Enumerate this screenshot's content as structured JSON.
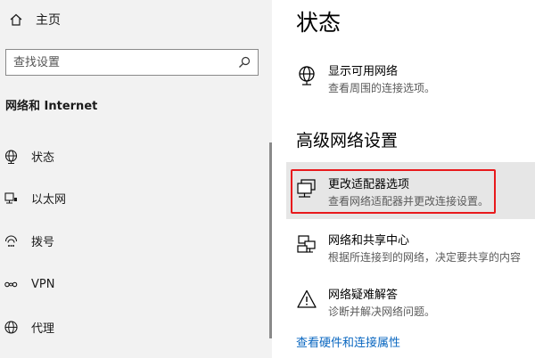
{
  "sidebar": {
    "home_label": "主页",
    "search": {
      "placeholder": "查找设置"
    },
    "section_label": "网络和 Internet",
    "items": [
      {
        "label": "状态",
        "icon": "globe-icon"
      },
      {
        "label": "以太网",
        "icon": "ethernet-icon"
      },
      {
        "label": "拨号",
        "icon": "dialup-icon"
      },
      {
        "label": "VPN",
        "icon": "vpn-icon"
      },
      {
        "label": "代理",
        "icon": "globe-icon"
      }
    ]
  },
  "main": {
    "title": "状态",
    "show_networks": {
      "title": "显示可用网络",
      "desc": "查看周围的连接选项。"
    },
    "advanced_heading": "高级网络设置",
    "adapter_options": {
      "title": "更改适配器选项",
      "desc": "查看网络适配器并更改连接设置。"
    },
    "sharing_center": {
      "title": "网络和共享中心",
      "desc": "根据所连接到的网络，决定要共享的内容"
    },
    "troubleshooter": {
      "title": "网络疑难解答",
      "desc": "诊断并解决网络问题。"
    },
    "hardware_link": "查看硬件和连接属性"
  },
  "colors": {
    "highlight_border": "#e8191c",
    "link": "#0a67c0",
    "sidebar_bg": "#f2f2f2"
  }
}
